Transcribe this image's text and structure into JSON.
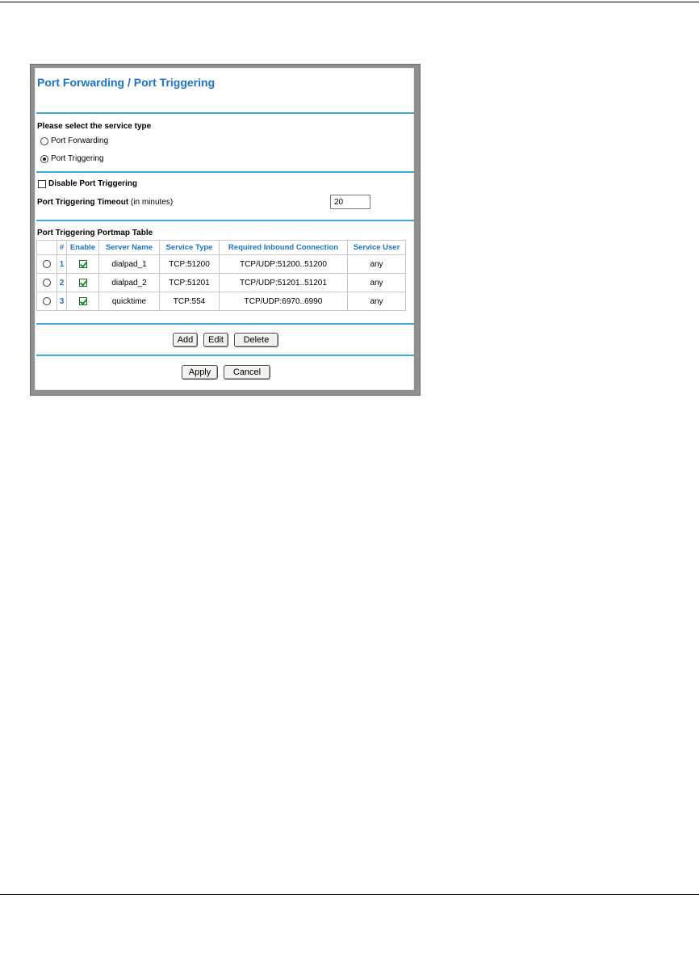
{
  "page_title": "Port Forwarding / Port Triggering",
  "service_type": {
    "label": "Please select the service type",
    "options": [
      {
        "label": "Port Forwarding",
        "selected": false
      },
      {
        "label": "Port Triggering",
        "selected": true
      }
    ]
  },
  "disable_trigger": {
    "label": "Disable Port Triggering",
    "checked": false
  },
  "timeout": {
    "label": "Port Triggering Timeout",
    "unit": " (in minutes)",
    "value": "20"
  },
  "table": {
    "title": "Port Triggering Portmap Table",
    "headers": [
      "#",
      "Enable",
      "Server Name",
      "Service Type",
      "Required Inbound Connection",
      "Service User"
    ],
    "rows": [
      {
        "num": "1",
        "enabled": true,
        "server": "dialpad_1",
        "type": "TCP:51200",
        "inbound": "TCP/UDP:51200..51200",
        "user": "any"
      },
      {
        "num": "2",
        "enabled": true,
        "server": "dialpad_2",
        "type": "TCP:51201",
        "inbound": "TCP/UDP:51201..51201",
        "user": "any"
      },
      {
        "num": "3",
        "enabled": true,
        "server": "quicktime",
        "type": "TCP:554",
        "inbound": "TCP/UDP:6970..6990",
        "user": "any"
      }
    ]
  },
  "buttons": {
    "add": "Add",
    "edit": "Edit",
    "delete": "Delete",
    "apply": "Apply",
    "cancel": "Cancel"
  },
  "colors": {
    "accent": "#1a74c9",
    "rule": "#45a6dd"
  }
}
